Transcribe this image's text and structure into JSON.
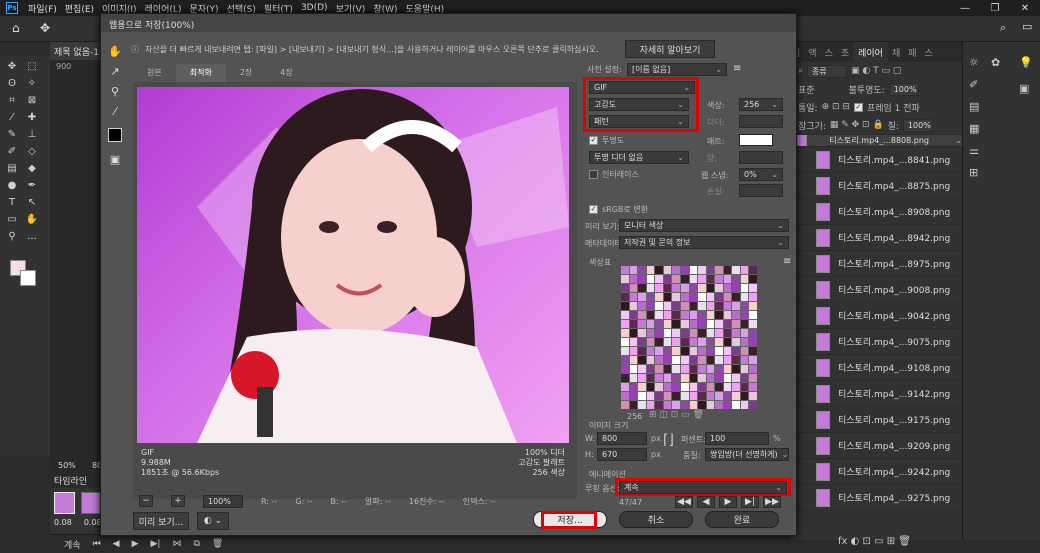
{
  "menubar": {
    "items": [
      "파일(F)",
      "편집(E)",
      "이미지(I)",
      "레이어(L)",
      "문자(Y)",
      "선택(S)",
      "필터(T)",
      "3D(D)",
      "보기(V)",
      "창(W)",
      "도움말(H)"
    ]
  },
  "document": {
    "tab": "제목 없음-1",
    "zoom": "50%",
    "zoom2": "80",
    "ruler": "900"
  },
  "timeline": {
    "title": "타임라인",
    "frame1": "0.08",
    "frame2": "0.08"
  },
  "statusbar": {
    "loop": "계속"
  },
  "dialog": {
    "title": "웹용으로 저장(100%)",
    "info": "자산을 더 빠르게 내보내려면 탭: [파일] > [내보내기] > [내보내기 형식...]을 사용하거나 레이어를 마우스 오른쪽 단추로 클릭하십시오.",
    "learn_more": "자세히 알아보기",
    "view_tabs": [
      "원본",
      "최적화",
      "2장",
      "4장"
    ],
    "image_info": {
      "format": "GIF",
      "size": "9.988M",
      "time": "1851초 @ 56.6Kbps",
      "right1": "100% 디더",
      "right2": "고감도 팔레트",
      "right3": "256 색상"
    },
    "bottom": {
      "zoom": "100%",
      "r": "R: --",
      "g": "G: --",
      "b": "B: --",
      "alpha": "알파: --",
      "hex": "16진수: --",
      "index": "인덱스: --"
    },
    "preview_btn": "미리 보기...",
    "settings": {
      "preset_label": "사전 설정:",
      "preset_value": "[이름 없음]",
      "format": "GIF",
      "reduction": "고감도",
      "dither_algo": "패턴",
      "colors_label": "색상:",
      "colors_value": "256",
      "dither_label": "디더:",
      "transparency": "투명도",
      "matte_label": "매트:",
      "trans_dither": "투명 디더 없음",
      "amount_label": "양:",
      "interlaced": "인터레이스",
      "web_snap_label": "웹 스냅:",
      "web_snap_value": "0%",
      "lossy_label": "손실:",
      "srgb": "sRGB로 변환",
      "preview_label": "미리 보기:",
      "preview_value": "모니터 색상",
      "metadata_label": "메타데이터:",
      "metadata_value": "저작권 및 문의 정보",
      "colortable_label": "색상표",
      "color_count": "256",
      "imagesize_label": "이미지 크기",
      "w_label": "W:",
      "w_value": "800",
      "h_label": "H:",
      "h_value": "670",
      "px": "px",
      "percent_label": "퍼센트:",
      "percent_value": "100",
      "percent_unit": "%",
      "quality_label": "품질:",
      "quality_value": "쌍입방(더 선명하게)",
      "animation_label": "애니메이션",
      "loop_label": "루핑 옵션:",
      "loop_value": "계속",
      "frame_counter": "47/47"
    },
    "buttons": {
      "save": "저장...",
      "cancel": "취소",
      "done": "완료"
    }
  },
  "layers_panel": {
    "tabs": [
      "입",
      "액",
      "스",
      "조",
      "레이어",
      "채",
      "패",
      "스"
    ],
    "kind": "종류",
    "mode": "표준",
    "opacity_label": "불투명도:",
    "opacity_value": "100%",
    "unify": "통일:",
    "propagate": "프레임 1 전파",
    "lock": "잠그기:",
    "fill": "칠:",
    "fill_value": "100%",
    "layers": [
      "티스토리.mp4_...8808.png",
      "티스토리.mp4_...8841.png",
      "티스토리.mp4_...8875.png",
      "티스토리.mp4_...8908.png",
      "티스토리.mp4_...8942.png",
      "티스토리.mp4_...8975.png",
      "티스토리.mp4_...9008.png",
      "티스토리.mp4_...9042.png",
      "티스토리.mp4_...9075.png",
      "티스토리.mp4_...9108.png",
      "티스토리.mp4_...9142.png",
      "티스토리.mp4_...9175.png",
      "티스토리.mp4_...9209.png",
      "티스토리.mp4_...9242.png",
      "티스토리.mp4_...9275.png"
    ]
  },
  "colors": {
    "highlight": "#e30000",
    "accent": "#31a8ff"
  }
}
